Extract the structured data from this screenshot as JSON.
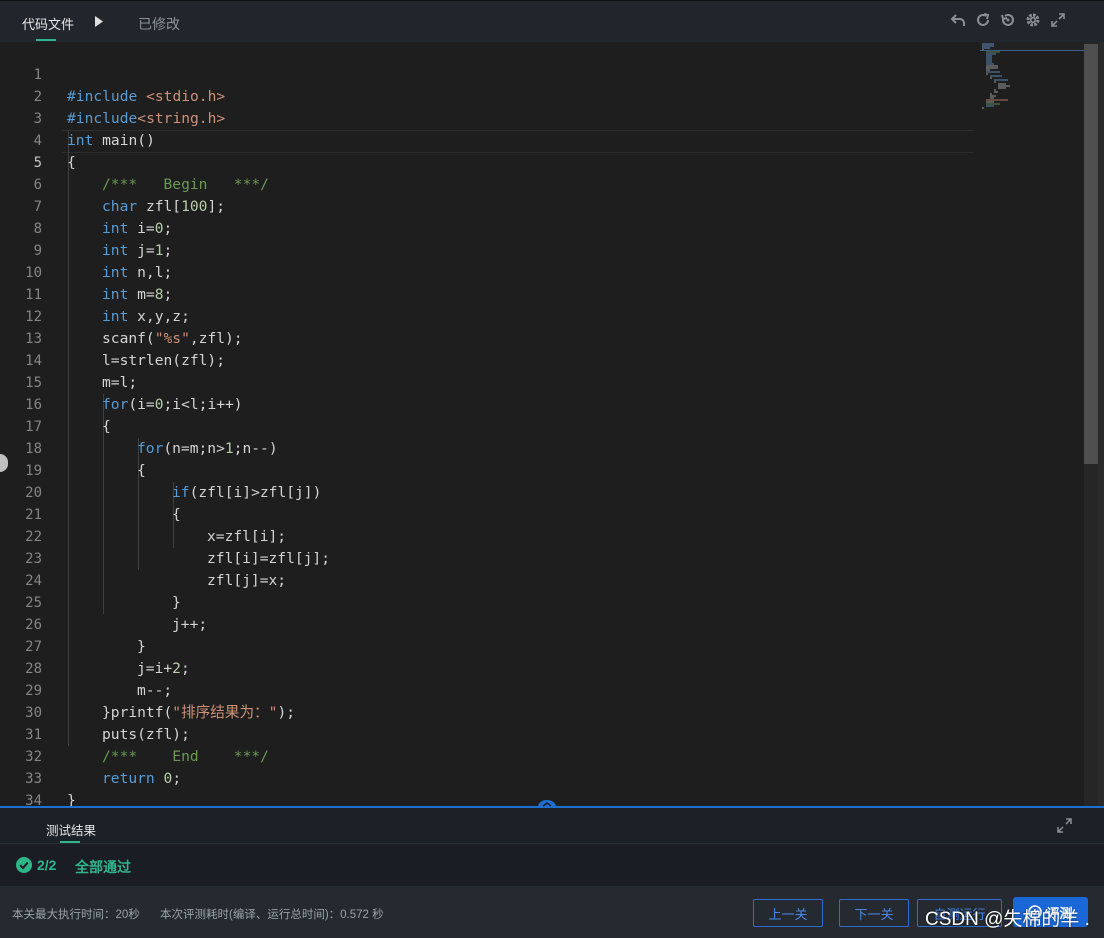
{
  "topbar": {
    "file_tab": "代码文件",
    "modified_label": "已修改",
    "icons": [
      "undo-icon",
      "refresh-icon",
      "restore-icon",
      "gear-icon",
      "fullscreen-icon"
    ]
  },
  "editor": {
    "line_numbers": [
      "1",
      "2",
      "3",
      "4",
      "5",
      "6",
      "7",
      "8",
      "9",
      "10",
      "11",
      "12",
      "13",
      "14",
      "15",
      "16",
      "17",
      "18",
      "19",
      "20",
      "21",
      "22",
      "23",
      "24",
      "25",
      "26",
      "27",
      "28",
      "29",
      "30",
      "31",
      "32",
      "33",
      "34"
    ],
    "active_line": "5",
    "code": {
      "l1_directive": "#include",
      "l1_header": "<stdio.h>",
      "l2_directive": "#include",
      "l2_header": "<string.h>",
      "l3_type": "int",
      "l3_rest": " main()",
      "l4": "{",
      "l5_comment": "/***   Begin   ***/",
      "l6_type": "char",
      "l6_a": " zfl[",
      "l6_num": "100",
      "l6_b": "];",
      "l7_type": "int",
      "l7_a": " i=",
      "l7_num": "0",
      "l7_b": ";",
      "l8_type": "int",
      "l8_a": " j=",
      "l8_num": "1",
      "l8_b": ";",
      "l9_type": "int",
      "l9_rest": " n,l;",
      "l10_type": "int",
      "l10_a": " m=",
      "l10_num": "8",
      "l10_b": ";",
      "l11_type": "int",
      "l11_rest": " x,y,z;",
      "l12_a": "scanf(",
      "l12_str": "\"%s\"",
      "l12_b": ",zfl);",
      "l13": "l=strlen(zfl);",
      "l14": "m=l;",
      "l15_kw": "for",
      "l15_a": "(i=",
      "l15_num": "0",
      "l15_b": ";i<l;i++)",
      "l16": "{",
      "l17_kw": "for",
      "l17_a": "(n=m;n>",
      "l17_num": "1",
      "l17_b": ";n--)",
      "l18": "{",
      "l19_kw": "if",
      "l19_rest": "(zfl[i]>zfl[j])",
      "l20": "{",
      "l21": "x=zfl[i];",
      "l22": "zfl[i]=zfl[j];",
      "l23": "zfl[j]=x;",
      "l24": "}",
      "l25": "j++;",
      "l26": "}",
      "l27_a": "j=i+",
      "l27_num": "2",
      "l27_b": ";",
      "l28": "m--;",
      "l29_a": "}printf(",
      "l29_str": "\"排序结果为：\"",
      "l29_b": ");",
      "l30": "puts(zfl);",
      "l31_comment": "/***    End    ***/",
      "l32_kw": "return",
      "l32_sp": " ",
      "l32_num": "0",
      "l32_b": ";",
      "l33": "}",
      "l34": ""
    }
  },
  "results": {
    "tab_label": "测试结果",
    "pass_count": "2/2",
    "pass_text": "全部通过"
  },
  "footer": {
    "max_time": "本关最大执行时间：20秒",
    "eval_time": "本次评测耗时(编译、运行总时间)：0.572 秒",
    "prev_button": "上一关",
    "next_button": "下一关",
    "custom_run_button": "自测运行",
    "eval_button": "评测",
    "watermark": "CSDN @失棉的羊 ."
  },
  "colors": {
    "accent_green": "#2fb58a",
    "accent_blue": "#1a67d8",
    "keyword": "#569cd6",
    "comment": "#6a9955",
    "number": "#b5cea8",
    "string": "#ce9178"
  }
}
